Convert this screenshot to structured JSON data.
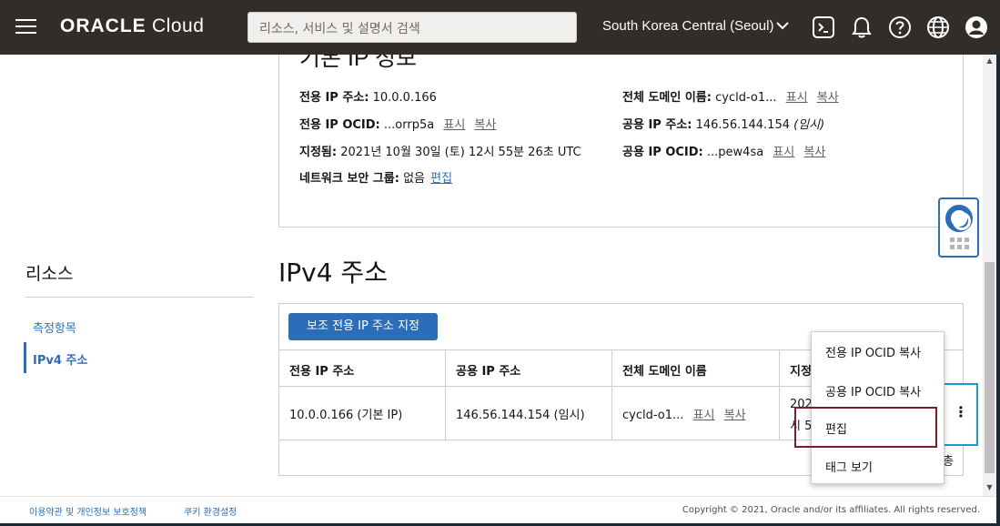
{
  "header": {
    "brand_bold": "ORACLE",
    "brand_light": "Cloud",
    "search_placeholder": "리소스, 서비스 및 설명서 검색",
    "region": "South Korea Central (Seoul)",
    "icons": [
      "cloud-shell-icon",
      "bell-icon",
      "help-icon",
      "globe-icon",
      "user-avatar-icon"
    ]
  },
  "info": {
    "title": "기본 IP 정보",
    "private_ip_label": "전용 IP 주소:",
    "private_ip_value": "10.0.0.166",
    "private_ocid_label": "전용 IP OCID:",
    "private_ocid_value": "...orrp5a",
    "assigned_label": "지정됨:",
    "assigned_value": "2021년 10월 30일 (토) 12시 55분 26초 UTC",
    "nsg_label": "네트워크 보안 그룹:",
    "nsg_value": "없음",
    "edit_link": "편집",
    "fqdn_label": "전체 도메인 이름:",
    "fqdn_value": "cycld-o1...",
    "public_ip_label": "공용 IP 주소:",
    "public_ip_value": "146.56.144.154",
    "public_ip_note": "(임시)",
    "public_ocid_label": "공용 IP OCID:",
    "public_ocid_value": "...pew4sa",
    "show_link": "표시",
    "copy_link": "복사"
  },
  "resources": {
    "title": "리소스",
    "items": [
      "측정항목",
      "IPv4 주소"
    ],
    "active": "IPv4 주소"
  },
  "ipv4": {
    "title": "IPv4 주소",
    "assign_button": "보조 전용 IP 주소 지정",
    "columns": [
      "전용 IP 주소",
      "공용 IP 주소",
      "전체 도메인 이름",
      "지정"
    ],
    "row": {
      "private_ip": "10.0.0.166 (기본 IP)",
      "public_ip": "146.56.144.154 (임시)",
      "fqdn": "cycld-o1...",
      "show": "표시",
      "copy": "복사",
      "assigned_partial_1": "202",
      "assigned_partial_2": "시 5"
    },
    "pager_partial": "총"
  },
  "action_menu": {
    "items": [
      "전용 IP OCID 복사",
      "공용 IP OCID 복사",
      "편집",
      "태그 보기"
    ],
    "highlighted": "편집"
  },
  "footer": {
    "terms": "이용약관 및 개인정보 보호정책",
    "cookies": "쿠키 환경설정",
    "copyright": "Copyright © 2021, Oracle and/or its affiliates. All rights reserved."
  },
  "colors": {
    "header_bg": "#312d2a",
    "accent": "#2b6db8",
    "focus_outline": "#1a9ad6",
    "highlight_outline": "#7b1e2a"
  }
}
